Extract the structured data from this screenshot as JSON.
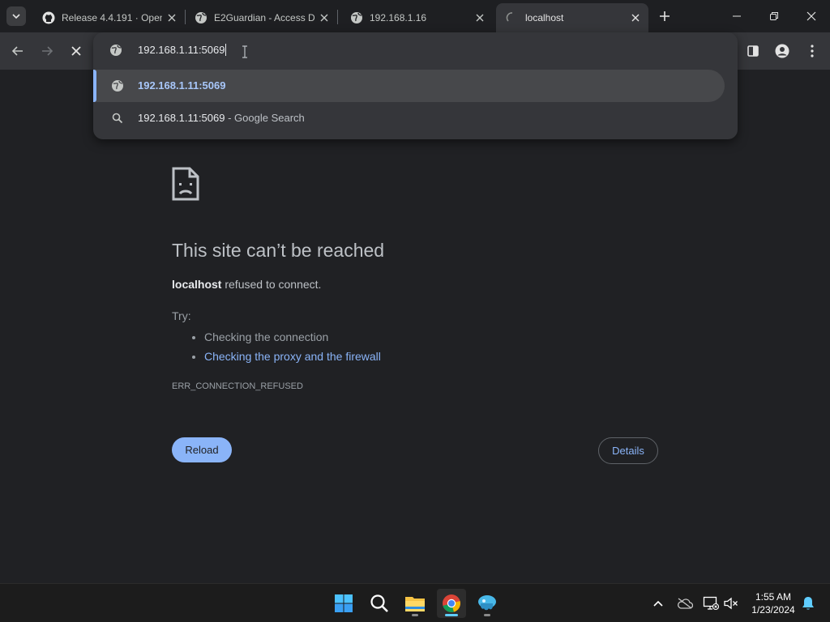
{
  "tabs": [
    {
      "title": "Release 4.4.191 · Open",
      "icon": "github-icon"
    },
    {
      "title": "E2Guardian - Access D",
      "icon": "globe-icon"
    },
    {
      "title": "192.168.1.16",
      "icon": "globe-icon"
    },
    {
      "title": "localhost",
      "icon": "loading-spinner-icon",
      "active": true
    }
  ],
  "omnibox": {
    "value": "192.168.1.11:5069",
    "suggestions": [
      {
        "text": "192.168.1.11:5069",
        "icon": "globe-icon",
        "selected": true
      },
      {
        "text": "192.168.1.11:5069",
        "description": " - Google Search",
        "icon": "search-icon"
      }
    ]
  },
  "error_page": {
    "title": "This site can’t be reached",
    "host": "localhost",
    "message": " refused to connect.",
    "try_label": "Try:",
    "suggestions": [
      "Checking the connection",
      "Checking the proxy and the firewall"
    ],
    "error_code": "ERR_CONNECTION_REFUSED",
    "reload_label": "Reload",
    "details_label": "Details"
  },
  "taskbar": {
    "apps": [
      "start-icon",
      "search-icon",
      "file-explorer-icon",
      "chrome-icon",
      "app-icon"
    ],
    "time": "1:55 AM",
    "date": "1/23/2024"
  },
  "colors": {
    "background": "#202124",
    "accent": "#8ab4f8",
    "toolbar": "#35363a"
  }
}
